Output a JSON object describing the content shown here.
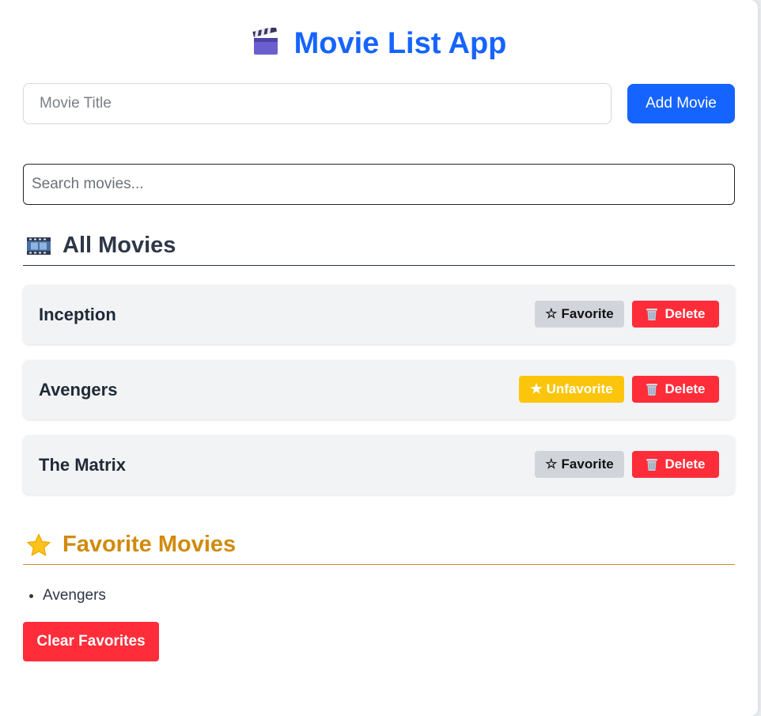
{
  "header": {
    "title": "Movie List App",
    "icon": "clapperboard-icon"
  },
  "add_form": {
    "placeholder": "Movie Title",
    "value": "",
    "button_label": "Add Movie"
  },
  "search": {
    "placeholder": "Search movies...",
    "value": ""
  },
  "all_movies": {
    "heading": "All Movies",
    "icon": "film-frames-icon",
    "items": [
      {
        "title": "Inception",
        "favorite": false,
        "fav_label": "Favorite",
        "delete_label": "Delete"
      },
      {
        "title": "Avengers",
        "favorite": true,
        "fav_label": "Unfavorite",
        "delete_label": "Delete"
      },
      {
        "title": "The Matrix",
        "favorite": false,
        "fav_label": "Favorite",
        "delete_label": "Delete"
      }
    ]
  },
  "favorites": {
    "heading": "Favorite Movies",
    "icon": "star-icon",
    "items": [
      "Avengers"
    ],
    "clear_label": "Clear Favorites"
  },
  "colors": {
    "primary": "#1664ff",
    "danger": "#ff2d3a",
    "favorite_active": "#fbc50c",
    "favorite_heading": "#d18a0c"
  }
}
